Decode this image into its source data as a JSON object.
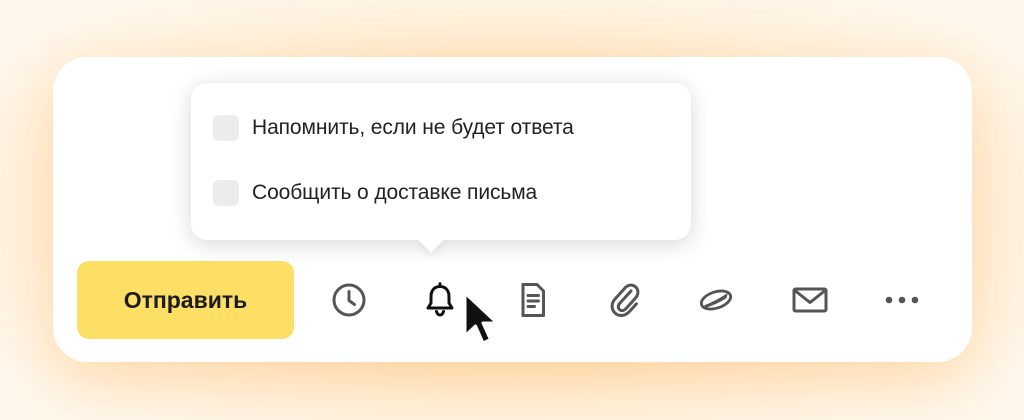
{
  "reminder_popup": {
    "options": [
      {
        "label": "Напомнить, если не будет ответа",
        "checked": false
      },
      {
        "label": "Сообщить о доставке письма",
        "checked": false
      }
    ]
  },
  "toolbar": {
    "send_label": "Отправить",
    "send_color": "#fedf65",
    "icons": [
      "clock-icon",
      "bell-icon",
      "document-icon",
      "paperclip-icon",
      "disk-icon",
      "envelope-icon",
      "more-icon"
    ]
  },
  "colors": {
    "icon": "#555555",
    "active_icon": "#111111",
    "checkbox": "#ececec",
    "background_glow": "#ffd9a8"
  }
}
